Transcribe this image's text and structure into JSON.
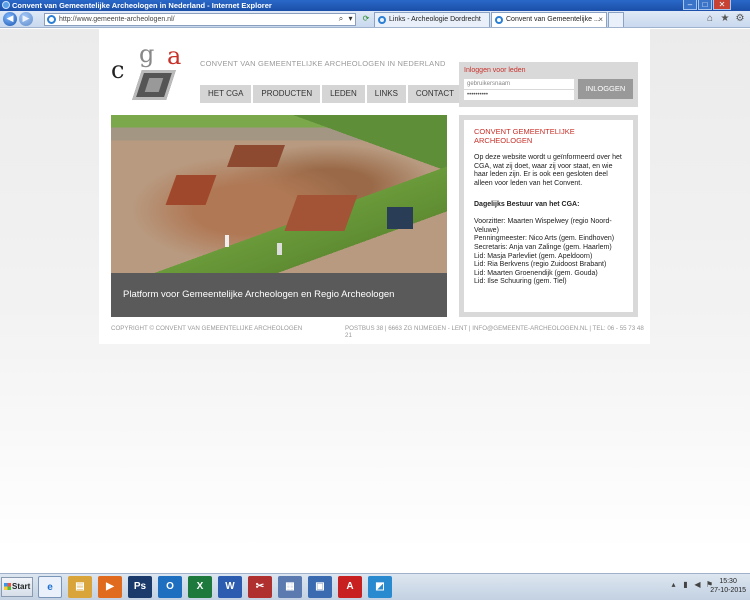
{
  "window": {
    "title": "Convent van Gemeentelijke Archeologen in Nederland - Internet Explorer"
  },
  "browser": {
    "url": "http://www.gemeente-archeologen.nl/",
    "tabs": [
      {
        "label": "Links - Archeologie Dordrecht",
        "active": false
      },
      {
        "label": "Convent van Gemeentelijke ...",
        "active": true
      }
    ]
  },
  "site": {
    "logo_letters": {
      "c": "c",
      "g": "g",
      "a": "a"
    },
    "slogan": "CONVENT VAN GEMEENTELIJKE ARCHEOLOGEN IN NEDERLAND",
    "menu": [
      "HET CGA",
      "PRODUCTEN",
      "LEDEN",
      "LINKS",
      "CONTACT"
    ],
    "login": {
      "title": "Inloggen voor leden",
      "username_placeholder": "gebruikersnaam",
      "password_value": "••••••••••",
      "button": "INLOGGEN"
    },
    "hero_caption": "Platform voor Gemeentelijke Archeologen en Regio Archeologen",
    "info": {
      "title": "CONVENT GEMEENTELIJKE ARCHEOLOGEN",
      "intro": "Op deze website wordt u geïnformeerd over het CGA, wat zij doet, waar zij voor staat, en wie haar leden zijn. Er is ook een gesloten deel alleen voor leden van het Convent.",
      "subtitle": "Dagelijks Bestuur van het CGA:",
      "members": [
        "Voorzitter: Maarten Wispelwey (regio Noord-Veluwe)",
        "Penningmeester: Nico Arts (gem. Eindhoven)",
        "Secretaris: Anja van Zalinge (gem. Haarlem)",
        "Lid: Masja Parlevliet (gem. Apeldoorn)",
        "Lid: Ria Berkvens (regio Zuidoost Brabant)",
        "Lid: Maarten Groenendijk (gem. Gouda)",
        "Lid: Ilse Schuuring (gem. Tiel)"
      ]
    },
    "footer": {
      "copyright": "COPYRIGHT © CONVENT VAN GEMEENTELIJKE ARCHEOLOGEN",
      "address": "POSTBUS 38 | 6663 ZG NIJMEGEN - LENT | INFO@GEMEENTE-ARCHEOLOGEN.NL | TEL: 06 - 55 73 48 21"
    }
  },
  "taskbar": {
    "start_label": "Start",
    "apps": [
      {
        "name": "internet-explorer",
        "glyph": "e",
        "color": "#1d6fd0"
      },
      {
        "name": "file-explorer",
        "glyph": "▤",
        "color": "#d9a53a"
      },
      {
        "name": "media-player",
        "glyph": "▶",
        "color": "#e06a1d"
      },
      {
        "name": "photoshop",
        "glyph": "Ps",
        "color": "#1a3a6b"
      },
      {
        "name": "outlook",
        "glyph": "O",
        "color": "#1e6fc0"
      },
      {
        "name": "excel",
        "glyph": "X",
        "color": "#1e7a3c"
      },
      {
        "name": "word",
        "glyph": "W",
        "color": "#2b5cb0"
      },
      {
        "name": "snipping-tool",
        "glyph": "✂",
        "color": "#b03030"
      },
      {
        "name": "notepad",
        "glyph": "▦",
        "color": "#5a7ab0"
      },
      {
        "name": "remote-desktop",
        "glyph": "▣",
        "color": "#3a6ab0"
      },
      {
        "name": "acrobat",
        "glyph": "A",
        "color": "#c82020"
      },
      {
        "name": "paint",
        "glyph": "◩",
        "color": "#2a8ad0"
      }
    ],
    "time": "15:30",
    "date": "27-10-2015"
  }
}
